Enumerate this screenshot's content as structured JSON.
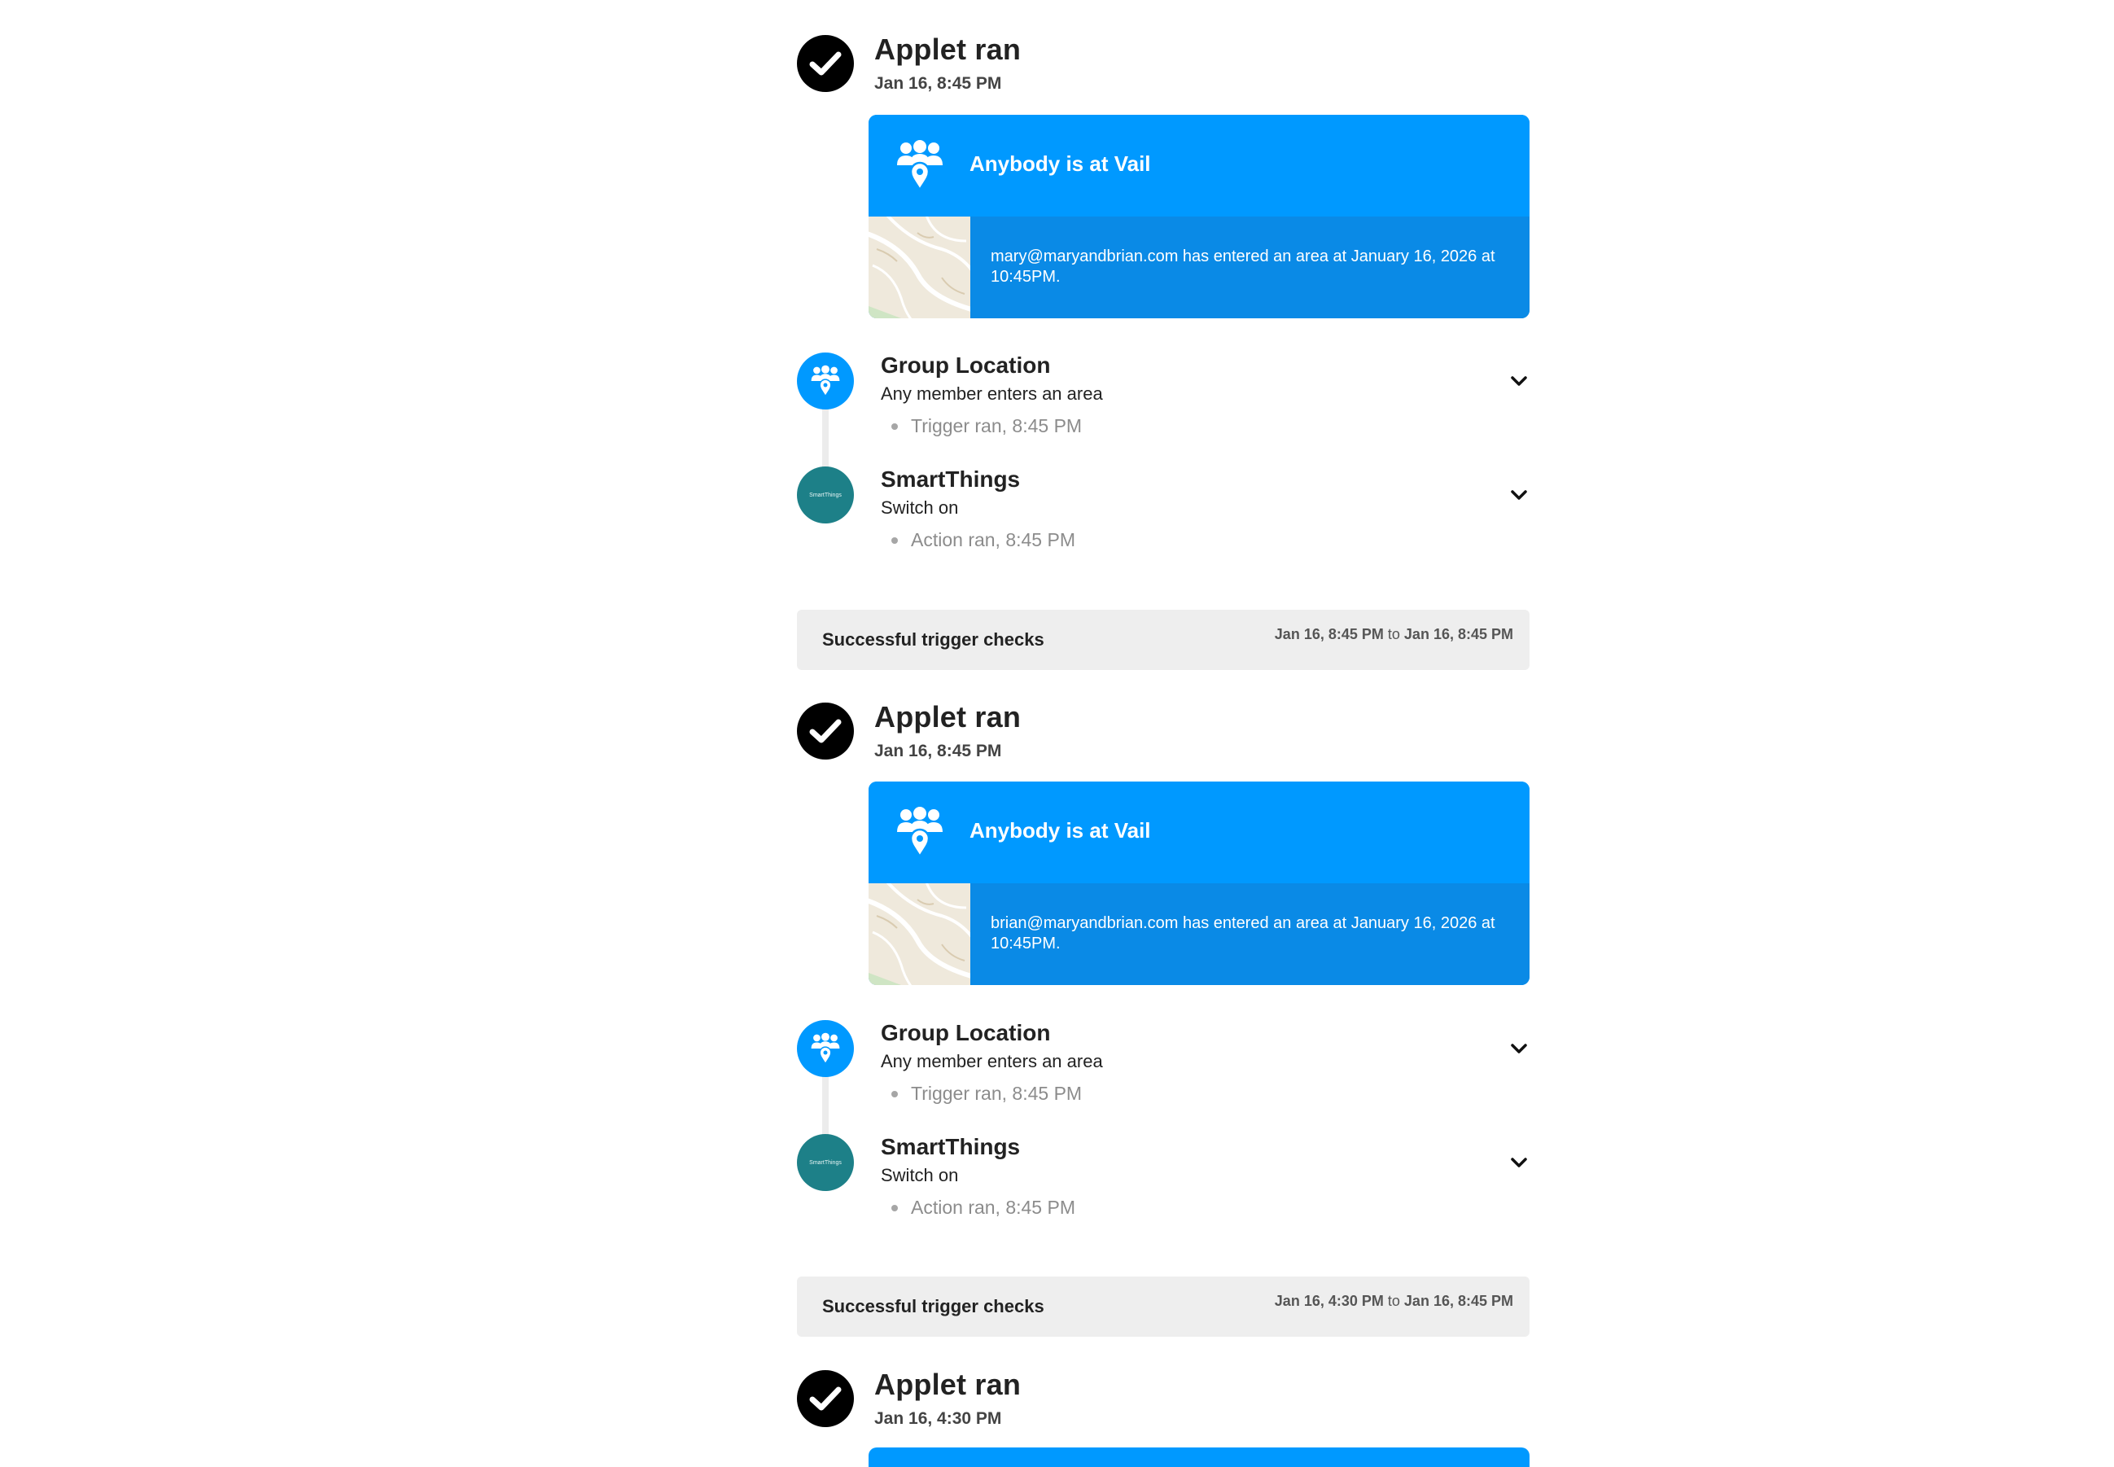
{
  "runs": [
    {
      "title": "Applet ran",
      "time": "Jan 16, 8:45 PM",
      "card": {
        "title": "Anybody is at Vail",
        "text": "mary@maryandbrian.com has entered an area at January 16, 2026 at 10:45PM."
      },
      "steps": [
        {
          "name": "Group Location",
          "desc": "Any member enters an area",
          "status": "Trigger ran, 8:45 PM",
          "icon": "group-location-icon"
        },
        {
          "name": "SmartThings",
          "desc": "Switch on",
          "status": "Action ran, 8:45 PM",
          "icon": "smartthings-icon",
          "icon_text": "SmartThings"
        }
      ]
    },
    {
      "title": "Applet ran",
      "time": "Jan 16, 8:45 PM",
      "card": {
        "title": "Anybody is at Vail",
        "text": "brian@maryandbrian.com has entered an area at January 16, 2026 at 10:45PM."
      },
      "steps": [
        {
          "name": "Group Location",
          "desc": "Any member enters an area",
          "status": "Trigger ran, 8:45 PM",
          "icon": "group-location-icon"
        },
        {
          "name": "SmartThings",
          "desc": "Switch on",
          "status": "Action ran, 8:45 PM",
          "icon": "smartthings-icon",
          "icon_text": "SmartThings"
        }
      ]
    },
    {
      "title": "Applet ran",
      "time": "Jan 16, 4:30 PM"
    }
  ],
  "trigger_checks": [
    {
      "label": "Successful trigger checks",
      "from": "Jan 16, 8:45 PM",
      "to_word": "to",
      "to": "Jan 16, 8:45 PM"
    },
    {
      "label": "Successful trigger checks",
      "from": "Jan 16, 4:30 PM",
      "to_word": "to",
      "to": "Jan 16, 8:45 PM"
    }
  ],
  "colors": {
    "brand_blue": "#0099ff",
    "card_body_blue": "#0a8ae6",
    "smartthings_teal": "#1d8088",
    "check_bar_bg": "#eeeeee"
  },
  "icons": {
    "check": "check-icon",
    "chevron": "chevron-down-icon"
  }
}
